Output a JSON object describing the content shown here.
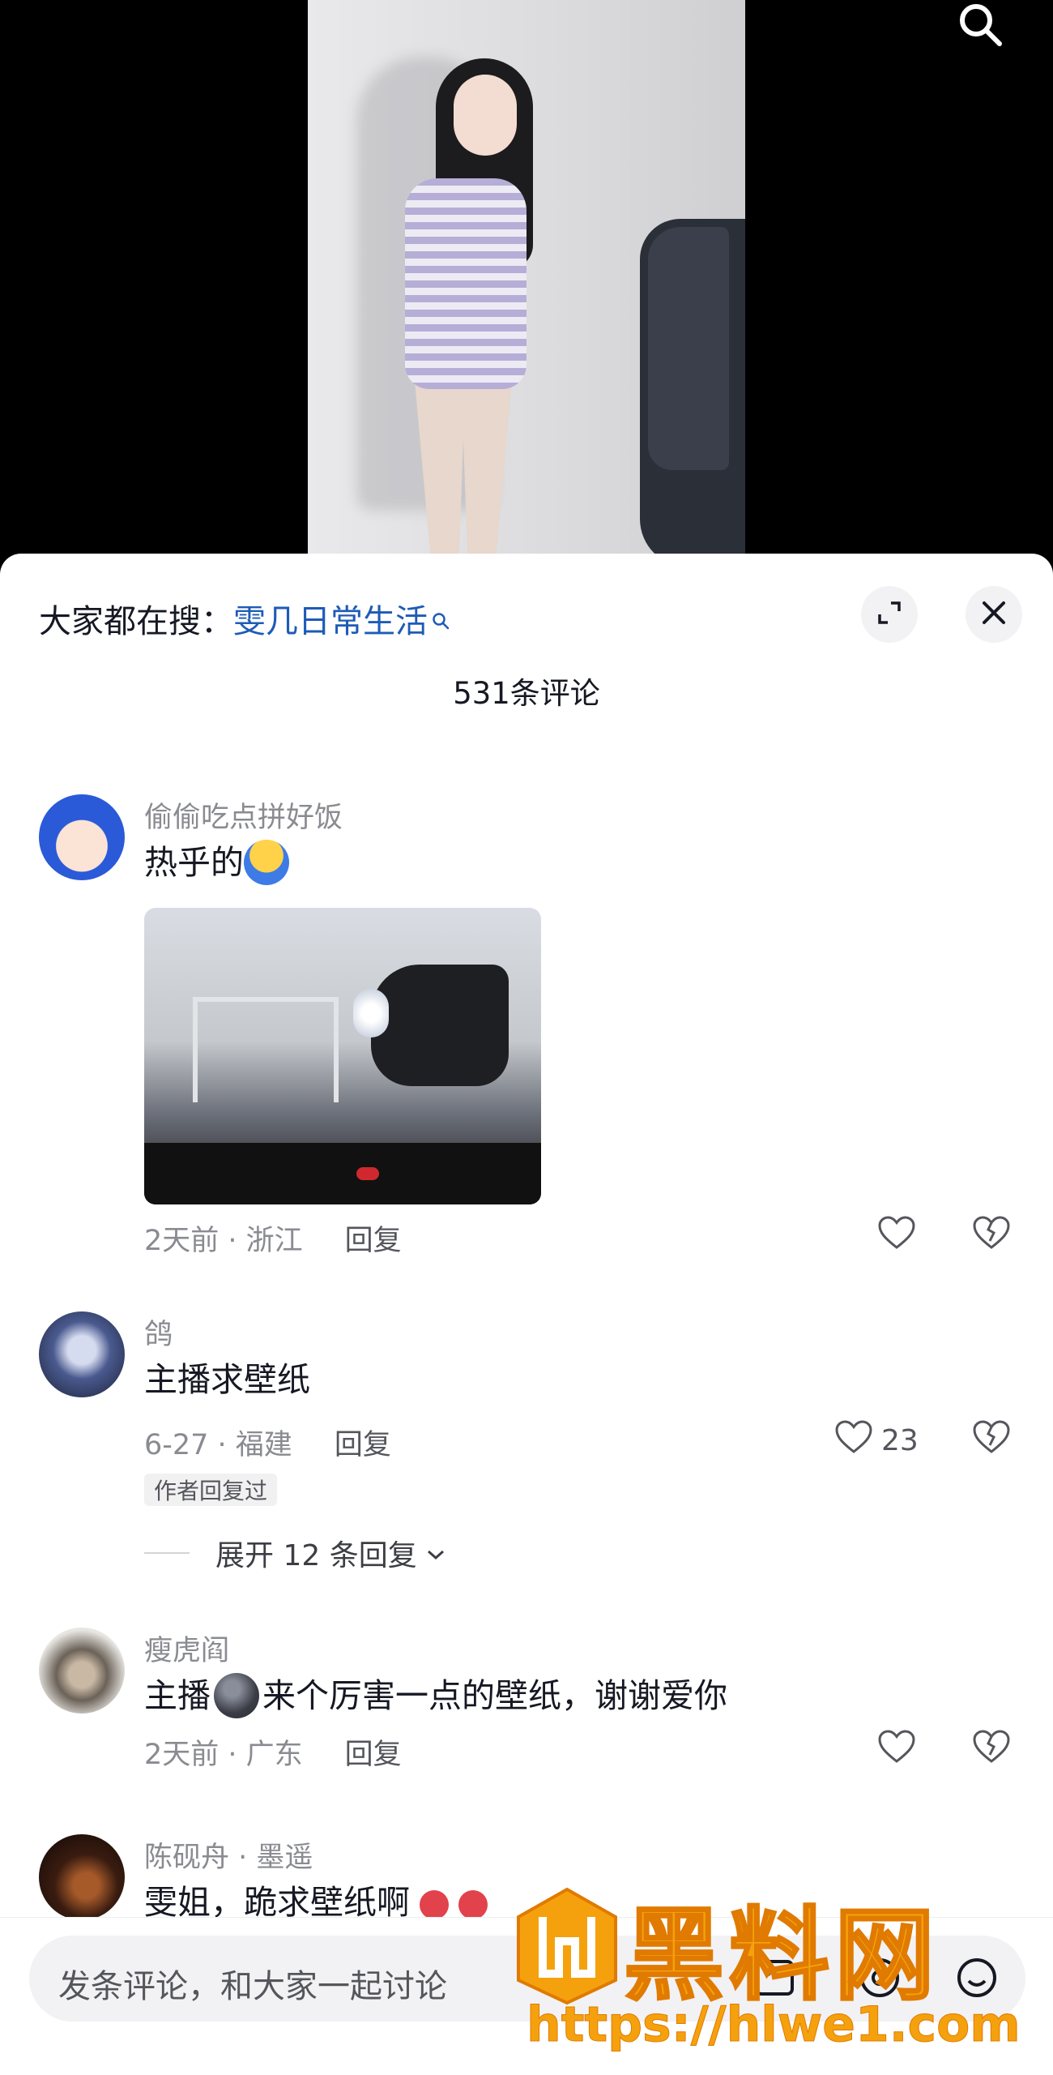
{
  "sheet": {
    "search_hint_label": "大家都在搜：",
    "search_hint_link": "雯几日常生活",
    "comment_count": "531条评论"
  },
  "comments": [
    {
      "user": "偷偷吃点拼好饭",
      "text": "热乎的",
      "emoji": "hot-face",
      "has_image": true,
      "time_location": "2天前 · 浙江",
      "reply": "回复"
    },
    {
      "user": "鸽",
      "text": "主播求壁纸",
      "time_location": "6-27 · 福建",
      "reply": "回复",
      "likes": "23",
      "author_badge": "作者回复过",
      "expand_replies": "展开 12 条回复"
    },
    {
      "user": "瘦虎阎",
      "text_before": "主播",
      "text_after": "来个厉害一点的壁纸，谢谢爱你",
      "time_location": "2天前 · 广东",
      "reply": "回复"
    },
    {
      "user": "陈砚舟 · 墨遥",
      "text": "雯姐，跪求壁纸啊"
    }
  ],
  "input": {
    "placeholder": "发条评论，和大家一起讨论"
  },
  "watermark": {
    "title": "黑料网",
    "url": "https://hlwe1.com"
  },
  "icons": {
    "top_search": "search-icon",
    "expand": "expand-icon",
    "close": "close-icon",
    "like": "heart-icon",
    "dislike": "broken-heart-icon"
  },
  "colors": {
    "link": "#1e5bb6",
    "secondary_text": "#8a8b91",
    "watermark": "#f5a10d"
  }
}
